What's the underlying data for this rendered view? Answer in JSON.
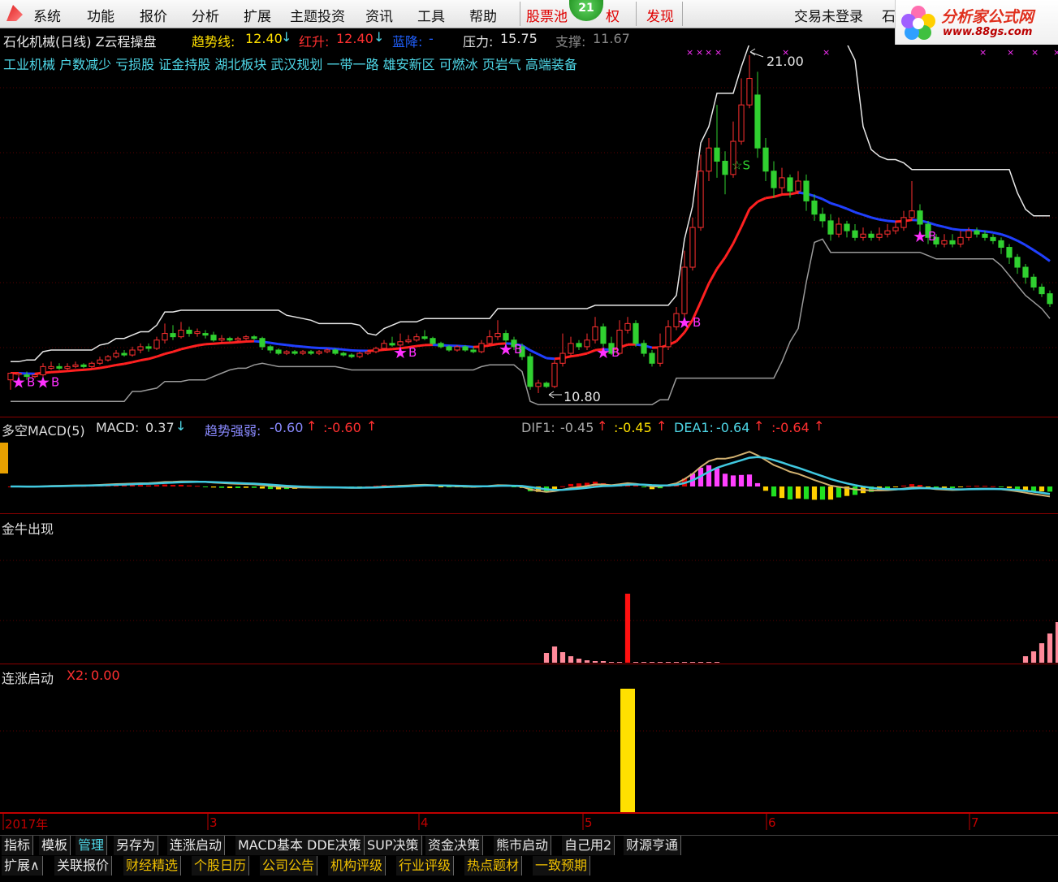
{
  "menu": {
    "items": [
      "系统",
      "功能",
      "报价",
      "分析",
      "扩展",
      "主题投资",
      "资讯",
      "工具",
      "帮助"
    ],
    "red_items": [
      "股票池",
      "权",
      "发现"
    ],
    "badge_count": "21",
    "login_status": "交易未登录",
    "truncated_right": "石"
  },
  "logo": {
    "text": "分析家公式网",
    "url": "www.88gs.com"
  },
  "main_chart": {
    "stock_title": "石化机械(日线) Z云程操盘",
    "trend_label": "趋势线:",
    "trend_value": "12.40",
    "red_label": "红升:",
    "red_value": "12.40",
    "blue_label": "蓝降:",
    "blue_value": "-",
    "pressure_label": "压力:",
    "pressure_value": "15.75",
    "support_label": "支撑:",
    "support_value": "11.67",
    "concepts": "工业机械 户数减少 亏损股 证金持股 湖北板块 武汉规划 一带一路 雄安新区 可燃冰 页岩气 高端装备",
    "high_marker": "21.00",
    "low_marker": "10.80",
    "buy_signal_label": "B",
    "sell_signal_label": "S"
  },
  "macd_pane": {
    "title": "多空MACD(5)",
    "macd_label": "MACD:",
    "macd_value": "0.37",
    "trend_label": "趋势强弱:",
    "trend_value": "-0.60",
    "trend_value2": ":-0.60",
    "dif_label": "DIF1:",
    "dif_value": "-0.45",
    "dif_value2": ":-0.45",
    "dea_label": "DEA1:",
    "dea_value": "-0.64",
    "dea_value2": ":-0.64"
  },
  "bull_pane": {
    "title": "金牛出现"
  },
  "rise_pane": {
    "title": "连涨启动",
    "x2_label": "X2:",
    "x2_value": "0.00"
  },
  "time_axis": {
    "labels": [
      "2017年",
      "3",
      "4",
      "5",
      "6",
      "7"
    ]
  },
  "tabs_row1": [
    "指标",
    "模板",
    "管理",
    "另存为",
    "连涨启动",
    "MACD基本",
    "DDE决策",
    "SUP决策",
    "资金决策",
    "熊市启动",
    "自己用2",
    "财源亨通"
  ],
  "tabs_row2": [
    "扩展∧",
    "关联报价",
    "财经精选",
    "个股日历",
    "公司公告",
    "机构评级",
    "行业评级",
    "热点题材",
    "一致预期"
  ],
  "colors": {
    "up": "#ff3030",
    "down": "#30d030",
    "trend_red": "#ff2020",
    "trend_blue": "#2040ff",
    "magenta": "#ff30ff",
    "yellow": "#ffe000",
    "cyan": "#4fd8e8"
  },
  "chart_data": {
    "type": "candlestick",
    "price_range": [
      10.8,
      21.0
    ],
    "candles": [
      [
        11.2,
        11.4,
        10.9,
        11.4
      ],
      [
        11.4,
        11.4,
        11.3,
        11.35
      ],
      [
        11.35,
        11.3,
        11.2,
        11.45
      ],
      [
        11.3,
        11.35,
        11.25,
        11.4
      ],
      [
        11.35,
        11.6,
        11.3,
        11.7
      ],
      [
        11.55,
        11.6,
        11.5,
        11.75
      ],
      [
        11.6,
        11.55,
        11.5,
        11.7
      ],
      [
        11.55,
        11.6,
        11.5,
        11.7
      ],
      [
        11.6,
        11.65,
        11.55,
        11.75
      ],
      [
        11.65,
        11.6,
        11.55,
        11.7
      ],
      [
        11.6,
        11.7,
        11.55,
        11.75
      ],
      [
        11.7,
        11.8,
        11.65,
        11.9
      ],
      [
        11.8,
        11.9,
        11.75,
        11.95
      ],
      [
        11.9,
        12.0,
        11.85,
        12.1
      ],
      [
        12.0,
        11.95,
        11.9,
        12.1
      ],
      [
        11.95,
        12.1,
        11.9,
        12.2
      ],
      [
        12.1,
        12.2,
        12.0,
        12.3
      ],
      [
        12.2,
        12.15,
        12.05,
        12.3
      ],
      [
        12.15,
        12.4,
        12.1,
        12.5
      ],
      [
        12.4,
        12.6,
        12.3,
        12.9
      ],
      [
        12.6,
        12.5,
        12.4,
        12.85
      ],
      [
        12.5,
        12.7,
        12.45,
        12.95
      ],
      [
        12.7,
        12.6,
        12.5,
        12.8
      ],
      [
        12.6,
        12.65,
        12.5,
        12.75
      ],
      [
        12.6,
        12.55,
        12.45,
        12.7
      ],
      [
        12.55,
        12.4,
        12.35,
        12.65
      ],
      [
        12.4,
        12.45,
        12.3,
        12.55
      ],
      [
        12.45,
        12.4,
        12.35,
        12.5
      ],
      [
        12.4,
        12.45,
        12.35,
        12.5
      ],
      [
        12.45,
        12.5,
        12.4,
        12.55
      ],
      [
        12.5,
        12.45,
        12.4,
        12.55
      ],
      [
        12.45,
        12.2,
        12.1,
        12.5
      ],
      [
        12.2,
        12.1,
        12.0,
        12.25
      ],
      [
        12.1,
        12.0,
        11.95,
        12.15
      ],
      [
        12.0,
        12.05,
        11.95,
        12.1
      ],
      [
        12.05,
        12.0,
        11.95,
        12.1
      ],
      [
        12.0,
        12.05,
        11.95,
        12.1
      ],
      [
        12.05,
        12.0,
        11.95,
        12.1
      ],
      [
        12.0,
        12.05,
        11.95,
        12.1
      ],
      [
        12.05,
        12.1,
        12.0,
        12.15
      ],
      [
        12.1,
        12.0,
        11.95,
        12.15
      ],
      [
        12.0,
        11.95,
        11.9,
        12.05
      ],
      [
        11.95,
        11.9,
        11.85,
        12.0
      ],
      [
        11.9,
        12.0,
        11.85,
        12.05
      ],
      [
        12.0,
        12.05,
        11.95,
        12.1
      ],
      [
        12.05,
        12.15,
        12.0,
        12.2
      ],
      [
        12.15,
        12.3,
        12.1,
        12.4
      ],
      [
        12.3,
        12.25,
        12.2,
        12.5
      ],
      [
        12.25,
        12.35,
        12.2,
        12.6
      ],
      [
        12.35,
        12.4,
        12.3,
        12.55
      ],
      [
        12.4,
        12.5,
        12.35,
        12.6
      ],
      [
        12.5,
        12.45,
        12.4,
        12.7
      ],
      [
        12.45,
        12.3,
        12.25,
        12.5
      ],
      [
        12.3,
        12.2,
        12.15,
        12.35
      ],
      [
        12.2,
        12.1,
        12.05,
        12.25
      ],
      [
        12.1,
        12.2,
        12.05,
        12.25
      ],
      [
        12.2,
        12.1,
        12.05,
        12.25
      ],
      [
        12.1,
        12.05,
        12.0,
        12.2
      ],
      [
        12.05,
        12.3,
        12.0,
        12.4
      ],
      [
        12.3,
        12.5,
        12.25,
        12.7
      ],
      [
        12.5,
        12.6,
        12.4,
        13.0
      ],
      [
        12.6,
        12.4,
        12.3,
        12.7
      ],
      [
        12.4,
        12.2,
        12.1,
        12.5
      ],
      [
        12.2,
        11.9,
        11.8,
        12.3
      ],
      [
        11.9,
        11.0,
        10.9,
        12.0
      ],
      [
        11.0,
        11.1,
        10.8,
        11.2
      ],
      [
        11.1,
        11.0,
        10.95,
        11.15
      ],
      [
        11.0,
        11.7,
        10.95,
        11.8
      ],
      [
        11.7,
        12.0,
        11.6,
        12.6
      ],
      [
        12.0,
        12.3,
        11.9,
        12.5
      ],
      [
        12.3,
        12.2,
        12.1,
        12.4
      ],
      [
        12.2,
        12.4,
        12.1,
        12.6
      ],
      [
        12.4,
        12.8,
        12.3,
        13.1
      ],
      [
        12.8,
        12.3,
        12.2,
        12.9
      ],
      [
        12.3,
        12.0,
        11.95,
        12.5
      ],
      [
        12.0,
        12.7,
        11.95,
        13.0
      ],
      [
        12.7,
        12.9,
        12.6,
        13.1
      ],
      [
        12.9,
        12.3,
        12.2,
        13.0
      ],
      [
        12.3,
        12.0,
        11.9,
        12.4
      ],
      [
        12.0,
        11.7,
        11.6,
        12.1
      ],
      [
        11.7,
        12.2,
        11.6,
        12.6
      ],
      [
        12.2,
        12.8,
        12.1,
        13.0
      ],
      [
        12.8,
        13.2,
        12.7,
        13.4
      ],
      [
        13.2,
        14.6,
        13.1,
        15.1
      ],
      [
        14.6,
        15.8,
        14.5,
        16.1
      ],
      [
        15.8,
        17.5,
        15.7,
        18.0
      ],
      [
        17.5,
        18.2,
        17.2,
        18.5
      ],
      [
        18.2,
        17.8,
        17.3,
        19.5
      ],
      [
        17.8,
        17.4,
        16.8,
        18.1
      ],
      [
        17.4,
        18.4,
        17.3,
        19.0
      ],
      [
        18.4,
        19.5,
        18.3,
        20.3
      ],
      [
        19.5,
        20.3,
        19.4,
        21.0
      ],
      [
        19.8,
        18.2,
        17.9,
        20.5
      ],
      [
        18.2,
        17.5,
        17.2,
        18.5
      ],
      [
        17.5,
        17.0,
        16.7,
        17.8
      ],
      [
        17.0,
        17.3,
        16.8,
        17.6
      ],
      [
        17.3,
        16.9,
        16.7,
        17.4
      ],
      [
        16.9,
        17.2,
        16.8,
        17.5
      ],
      [
        17.2,
        16.6,
        16.3,
        17.4
      ],
      [
        16.6,
        16.2,
        16.0,
        16.8
      ],
      [
        16.2,
        16.0,
        15.8,
        16.4
      ],
      [
        16.0,
        15.6,
        15.4,
        16.2
      ],
      [
        15.6,
        15.9,
        15.5,
        16.1
      ],
      [
        15.9,
        15.7,
        15.5,
        16.0
      ],
      [
        15.7,
        15.5,
        15.4,
        15.9
      ],
      [
        15.5,
        15.6,
        15.4,
        15.8
      ],
      [
        15.6,
        15.5,
        15.4,
        15.7
      ],
      [
        15.5,
        15.6,
        15.4,
        15.8
      ],
      [
        15.6,
        15.7,
        15.5,
        15.9
      ],
      [
        15.7,
        15.8,
        15.6,
        16.0
      ],
      [
        15.8,
        16.1,
        15.7,
        16.3
      ],
      [
        16.1,
        16.3,
        16.0,
        17.2
      ],
      [
        16.3,
        15.9,
        15.7,
        16.5
      ],
      [
        15.9,
        15.5,
        15.3,
        16.0
      ],
      [
        15.5,
        15.3,
        15.2,
        15.6
      ],
      [
        15.3,
        15.4,
        15.2,
        15.6
      ],
      [
        15.4,
        15.3,
        15.2,
        15.6
      ],
      [
        15.3,
        15.5,
        15.2,
        15.7
      ],
      [
        15.5,
        15.7,
        15.4,
        15.8
      ],
      [
        15.7,
        15.6,
        15.5,
        15.8
      ],
      [
        15.6,
        15.5,
        15.4,
        15.7
      ],
      [
        15.5,
        15.4,
        15.3,
        15.6
      ],
      [
        15.4,
        15.2,
        15.0,
        15.5
      ],
      [
        15.2,
        14.9,
        14.7,
        15.3
      ],
      [
        14.9,
        14.6,
        14.4,
        15.0
      ],
      [
        14.6,
        14.3,
        14.1,
        14.7
      ],
      [
        14.3,
        14.0,
        13.9,
        14.4
      ],
      [
        14.0,
        13.8,
        13.7,
        14.1
      ],
      [
        13.8,
        13.5,
        13.4,
        13.9
      ]
    ]
  }
}
